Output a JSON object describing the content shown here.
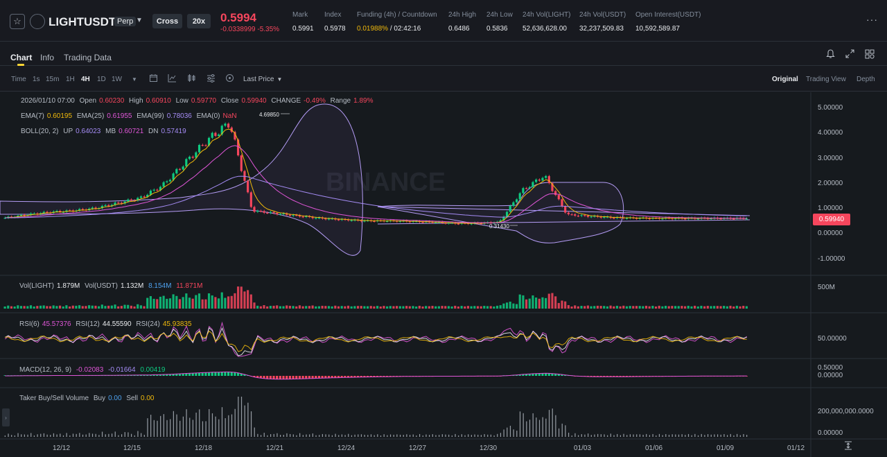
{
  "header": {
    "star_icon": "star-icon",
    "symbol": "LIGHTUSDT",
    "contract_type": "Perp",
    "margin_mode": "Cross",
    "leverage": "20x",
    "last_price": "0.5994",
    "change": "-0.0338999 -5.35%",
    "stats": [
      {
        "label": "Mark",
        "value": "0.5991"
      },
      {
        "label": "Index",
        "value": "0.5978"
      },
      {
        "label": "Funding (4h) / Countdown",
        "value_a": "0.01988%",
        "value_b": " / 02:42:16"
      },
      {
        "label": "24h High",
        "value": "0.6486"
      },
      {
        "label": "24h Low",
        "value": "0.5836"
      },
      {
        "label": "24h Vol(LIGHT)",
        "value": "52,636,628.00"
      },
      {
        "label": "24h Vol(USDT)",
        "value": "32,237,509.83"
      },
      {
        "label": "Open Interest(USDT)",
        "value": "10,592,589.87"
      }
    ],
    "more": "···"
  },
  "tabs": [
    {
      "label": "Chart",
      "active": true
    },
    {
      "label": "Info",
      "active": false
    },
    {
      "label": "Trading Data",
      "active": false
    }
  ],
  "toolbar": {
    "time_label": "Time",
    "intervals": [
      "1s",
      "15m",
      "1H",
      "4H",
      "1D",
      "1W"
    ],
    "active_interval": "4H",
    "price_type": "Last Price",
    "views": [
      "Original",
      "Trading View",
      "Depth"
    ],
    "active_view": "Original"
  },
  "chart_info": {
    "ohlc": {
      "date": "2026/01/10 07:00",
      "open_label": "Open",
      "open": "0.60230",
      "high_label": "High",
      "high": "0.60910",
      "low_label": "Low",
      "low": "0.59770",
      "close_label": "Close",
      "close": "0.59940",
      "change_label": "CHANGE",
      "change": "-0.49%",
      "range_label": "Range",
      "range": "1.89%"
    },
    "ema": {
      "ema7_label": "EMA(7)",
      "ema7": "0.60195",
      "ema25_label": "EMA(25)",
      "ema25": "0.61955",
      "ema99_label": "EMA(99)",
      "ema99": "0.78036",
      "ema0_label": "EMA(0)",
      "ema0": "NaN"
    },
    "boll": {
      "label": "BOLL(20, 2)",
      "up_label": "UP",
      "up": "0.64023",
      "mb_label": "MB",
      "mb": "0.60721",
      "dn_label": "DN",
      "dn": "0.57419"
    },
    "vol": {
      "label_a": "Vol(LIGHT)",
      "a": "1.879M",
      "label_b": "Vol(USDT)",
      "b": "1.132M",
      "c": "8.154M",
      "d": "11.871M"
    },
    "rsi": {
      "rsi6_label": "RSI(6)",
      "rsi6": "45.57376",
      "rsi12_label": "RSI(12)",
      "rsi12": "44.55590",
      "rsi24_label": "RSI(24)",
      "rsi24": "45.93835"
    },
    "macd": {
      "label": "MACD(12, 26, 9)",
      "dif": "-0.02083",
      "dea": "-0.01664",
      "hist": "0.00419"
    },
    "taker": {
      "label": "Taker Buy/Sell Volume",
      "buy_label": "Buy",
      "buy": "0.00",
      "sell_label": "Sell",
      "sell": "0.00"
    },
    "current_price_tag": "0.59940",
    "max_label": "4.69850",
    "min_label": "0.31430",
    "watermark": "BINANCE"
  },
  "chart_data": {
    "type": "line",
    "x": [
      "12/12",
      "12/15",
      "12/18",
      "12/21",
      "12/24",
      "12/27",
      "12/30",
      "01/03",
      "01/06",
      "01/09",
      "01/12"
    ],
    "ylim": [
      -1.5,
      5.5
    ],
    "price_ticks": [
      "5.00000",
      "4.00000",
      "3.00000",
      "2.00000",
      "1.00000",
      "0.00000",
      "-1.00000"
    ],
    "volume_ticks": [
      "500M"
    ],
    "rsi_ticks": [
      "50.00000"
    ],
    "macd_ticks": [
      "0.50000",
      "0.00000"
    ],
    "taker_ticks": [
      "200,000,000.0000",
      "0.00000"
    ],
    "series": [
      {
        "values": [
          0.62,
          0.75,
          0.85,
          0.9,
          1.0,
          1.2,
          1.4,
          1.9,
          2.8,
          3.7,
          4.4,
          0.9,
          0.8,
          0.7,
          0.6,
          0.55,
          0.5,
          0.5,
          0.48,
          0.45,
          0.4,
          0.4,
          0.45,
          1.7,
          2.3,
          0.75,
          0.68,
          0.63,
          0.61,
          0.6,
          0.6,
          0.6,
          0.6,
          0.6
        ]
      }
    ],
    "colors": {
      "up": "#0ecb81",
      "down": "#f6465d",
      "ema7": "#f0b90b",
      "ema25": "#e056d8",
      "ema99": "#a58cf5",
      "boll": "#b49cf5"
    }
  }
}
